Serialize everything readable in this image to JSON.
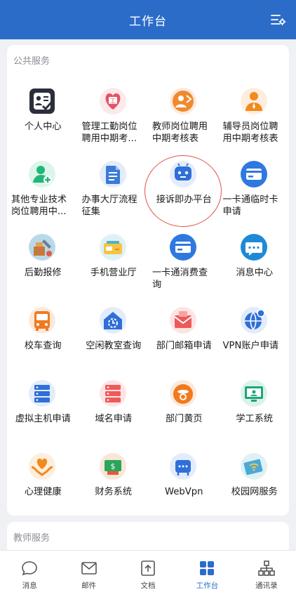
{
  "header": {
    "title": "工作台"
  },
  "sections": {
    "public": {
      "title": "公共服务"
    },
    "teacher": {
      "title": "教师服务"
    }
  },
  "apps": [
    {
      "label": "个人中心",
      "icon": "personal-center-icon"
    },
    {
      "label": "管理工勤岗位聘用中期考...",
      "icon": "heart-badge-icon"
    },
    {
      "label": "教师岗位聘用中期考核表",
      "icon": "teacher-icon"
    },
    {
      "label": "辅导员岗位聘用中期考核表",
      "icon": "counselor-icon"
    },
    {
      "label": "其他专业技术岗位聘用中...",
      "icon": "add-user-icon"
    },
    {
      "label": "办事大厅流程征集",
      "icon": "document-icon"
    },
    {
      "label": "接诉即办平台",
      "icon": "robot-icon"
    },
    {
      "label": "一卡通临时卡申请",
      "icon": "card-icon"
    },
    {
      "label": "后勤报修",
      "icon": "repair-icon"
    },
    {
      "label": "手机营业厅",
      "icon": "mobile-hall-icon"
    },
    {
      "label": "一卡通消费查询",
      "icon": "card-consume-icon"
    },
    {
      "label": "消息中心",
      "icon": "message-icon"
    },
    {
      "label": "校车查询",
      "icon": "bus-icon"
    },
    {
      "label": "空闲教室查询",
      "icon": "classroom-icon"
    },
    {
      "label": "部门邮箱申请",
      "icon": "mailbox-icon"
    },
    {
      "label": "VPN账户申请",
      "icon": "vpn-icon"
    },
    {
      "label": "虚拟主机申请",
      "icon": "server-icon"
    },
    {
      "label": "域名申请",
      "icon": "domain-icon"
    },
    {
      "label": "部门黄页",
      "icon": "phone-icon"
    },
    {
      "label": "学工系统",
      "icon": "student-system-icon"
    },
    {
      "label": "心理健康",
      "icon": "mental-health-icon"
    },
    {
      "label": "财务系统",
      "icon": "finance-icon"
    },
    {
      "label": "WebVpn",
      "icon": "webvpn-icon"
    },
    {
      "label": "校园网服务",
      "icon": "wifi-icon"
    }
  ],
  "tabs": [
    {
      "label": "消息",
      "icon": "chat-icon"
    },
    {
      "label": "邮件",
      "icon": "mail-icon"
    },
    {
      "label": "文档",
      "icon": "document-tab-icon"
    },
    {
      "label": "工作台",
      "icon": "workbench-icon",
      "active": true
    },
    {
      "label": "通讯录",
      "icon": "contacts-icon"
    }
  ],
  "colors": {
    "brand": "#2c6cc9",
    "annotation": "#e0524a"
  }
}
